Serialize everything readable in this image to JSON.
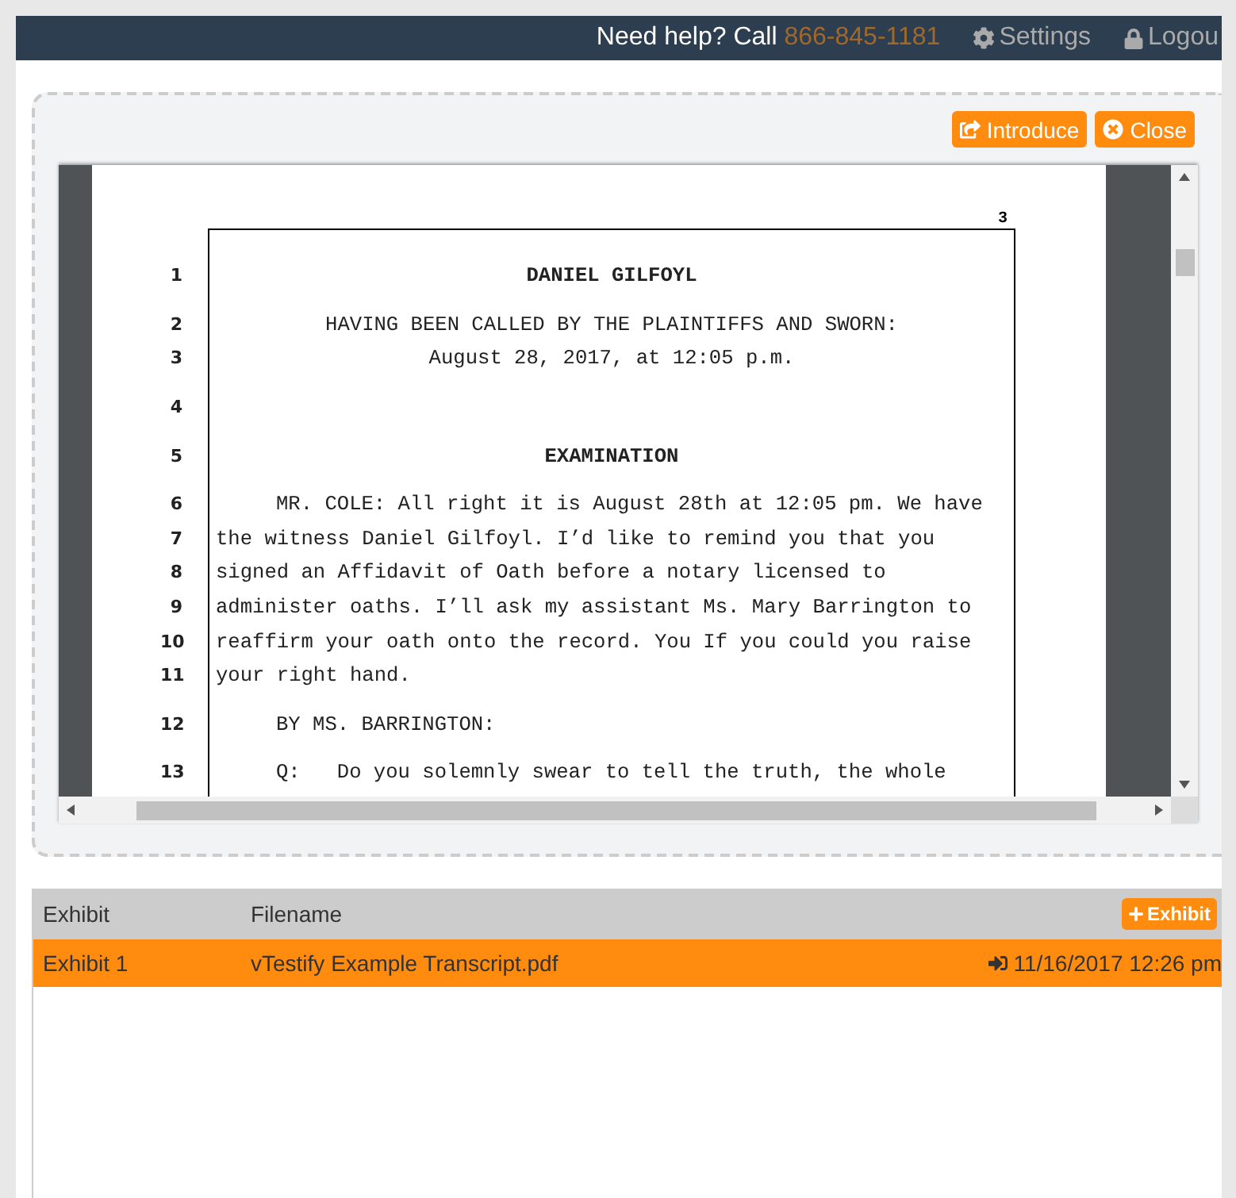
{
  "header": {
    "help_text": "Need help? Call",
    "phone": "866-845-1181",
    "settings": "Settings",
    "logout": "Logou"
  },
  "viewer": {
    "buttons": [
      {
        "kind": "introduce",
        "label": "Introduce"
      },
      {
        "kind": "close",
        "label": "Close"
      }
    ],
    "page_number": "3",
    "lines": [
      {
        "number": "1",
        "kind": "heading",
        "text": "DANIEL GILFOYL"
      },
      {
        "number": "2",
        "kind": "center",
        "text": "HAVING BEEN CALLED BY THE PLAINTIFFS AND SWORN:"
      },
      {
        "number": "3",
        "kind": "center",
        "text": "August 28, 2017, at 12:05 p.m."
      },
      {
        "number": "4",
        "kind": "blank"
      },
      {
        "number": "5",
        "kind": "heading",
        "text": "EXAMINATION"
      },
      {
        "number": "6",
        "kind": "para",
        "text": "MR. COLE: All right it is August 28th at 12:05 pm. We have"
      },
      {
        "number": "7",
        "kind": "cont",
        "text": "the witness Daniel Gilfoyl. I’d like to remind you that you"
      },
      {
        "number": "8",
        "kind": "cont",
        "text": "signed an Affidavit of Oath before a notary licensed to"
      },
      {
        "number": "9",
        "kind": "cont",
        "text": "administer oaths. I’ll ask my assistant Ms. Mary Barrington to"
      },
      {
        "number": "10",
        "kind": "cont",
        "text": "reaffirm your oath onto the record. You If you could you raise"
      },
      {
        "number": "11",
        "kind": "cont",
        "text": "your right hand."
      },
      {
        "number": "12",
        "kind": "para",
        "text": "BY MS. BARRINGTON:"
      },
      {
        "number": "13",
        "kind": "para",
        "text": "Q:   Do you solemnly swear to tell the truth, the whole"
      }
    ]
  },
  "exhibits": {
    "columns": [
      "Exhibit",
      "Filename"
    ],
    "add_button": "Exhibit",
    "rows": [
      {
        "exhibit": "Exhibit 1",
        "filename": "vTestify Example Transcript.pdf",
        "date": "11/16/2017 12:26 pm",
        "selected": true
      }
    ]
  }
}
